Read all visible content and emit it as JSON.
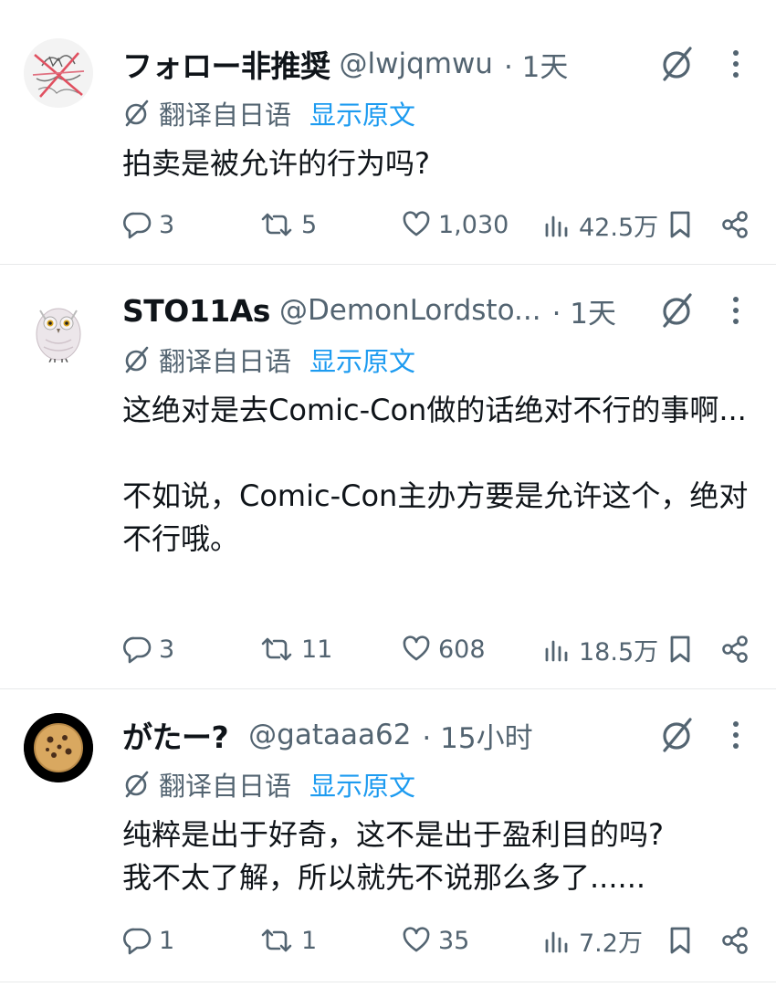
{
  "colors": {
    "accent": "#1d9bf0",
    "secondary_text": "#536471",
    "divider": "#e7e9ea"
  },
  "tweets": [
    {
      "display_name": "フォロー非推奨",
      "handle": "@lwjqmwu",
      "time": "· 1天",
      "translated_label": "翻译自日语",
      "show_original": "显示原文",
      "text": "拍卖是被允许的行为吗?",
      "replies": "3",
      "retweets": "5",
      "likes": "1,030",
      "views": "42.5万",
      "avatar_icon": "sketch-avatar-icon"
    },
    {
      "display_name": "STO11As",
      "handle": "@DemonLordsto...",
      "time": "· 1天",
      "translated_label": "翻译自日语",
      "show_original": "显示原文",
      "text": "这绝对是去Comic-Con做的话绝对不行的事啊...\n\n不如说，Comic-Con主办方要是允许这个，绝对不行哦。",
      "replies": "3",
      "retweets": "11",
      "likes": "608",
      "views": "18.5万",
      "avatar_icon": "owl-avatar-icon"
    },
    {
      "display_name": "がたー?",
      "handle": "@gataaa62",
      "time": "· 15小时",
      "translated_label": "翻译自日语",
      "show_original": "显示原文",
      "text": "纯粹是出于好奇，这不是出于盈利目的吗?\n我不太了解，所以就先不说那么多了......",
      "replies": "1",
      "retweets": "1",
      "likes": "35",
      "views": "7.2万",
      "avatar_icon": "cookie-avatar-icon"
    }
  ]
}
